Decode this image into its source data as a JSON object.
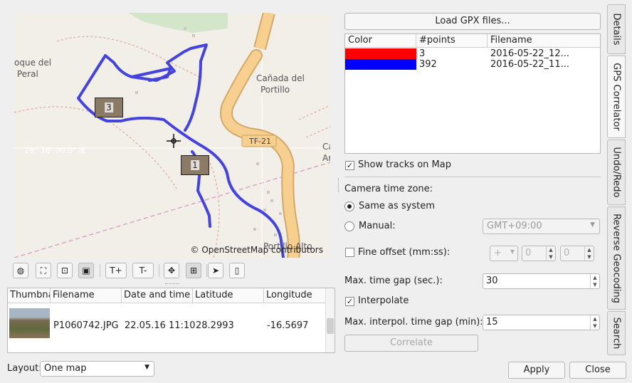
{
  "map": {
    "places": [
      "oque del",
      "Peral",
      "Cañada del",
      "Portillo",
      "TF-21",
      "Ca",
      "Ar",
      "Portillo Alto"
    ],
    "coordinate_label": "28° 18' 00,0\" N",
    "markers": [
      "3",
      "1"
    ],
    "attribution": "© OpenStreetMap contributors",
    "track_color": "#4444dd"
  },
  "toolbar": {
    "icons": [
      "globe-icon",
      "zoom-fit-icon",
      "zoom-selection-icon",
      "thumbnail-icon",
      "increase-thumbnail-label",
      "decrease-thumbnail-label",
      "pan-icon",
      "select-area-icon",
      "cursor-icon",
      "bookmark-icon"
    ],
    "increase_label": "T+",
    "decrease_label": "T-"
  },
  "image_table": {
    "columns": [
      "Thumbnail",
      "Filename",
      "Date and time",
      "Latitude",
      "Longitude"
    ],
    "rows": [
      {
        "filename": "P1060742.JPG",
        "datetime": "22.05.16 11:10",
        "latitude": "28.2993",
        "longitude": "-16.5697"
      }
    ]
  },
  "layout": {
    "label": "Layout:",
    "value": "One map"
  },
  "gps": {
    "load_button": "Load GPX files...",
    "columns": [
      "Color",
      "#points",
      "Filename"
    ],
    "tracks": [
      {
        "color": "#ff0000",
        "points": "3",
        "filename": "2016-05-22_12..."
      },
      {
        "color": "#0000ff",
        "points": "392",
        "filename": "2016-05-22_11..."
      }
    ],
    "show_tracks": "Show tracks on Map",
    "camera_tz_label": "Camera time zone:",
    "same_as_system": "Same as system",
    "manual": "Manual:",
    "manual_value": "GMT+09:00",
    "fine_offset": "Fine offset (mm:ss):",
    "fine_sign": "+",
    "fine_mm": "0",
    "fine_ss": "0",
    "max_gap_label": "Max. time gap (sec.):",
    "max_gap": "30",
    "interpolate": "Interpolate",
    "max_interp_label": "Max. interpol. time gap (min):",
    "max_interp": "15",
    "correlate": "Correlate"
  },
  "tabs": [
    "Details",
    "GPS Correlator",
    "Undo/Redo",
    "Reverse Geocoding",
    "Search"
  ],
  "buttons": {
    "apply": "Apply",
    "close": "Close"
  }
}
